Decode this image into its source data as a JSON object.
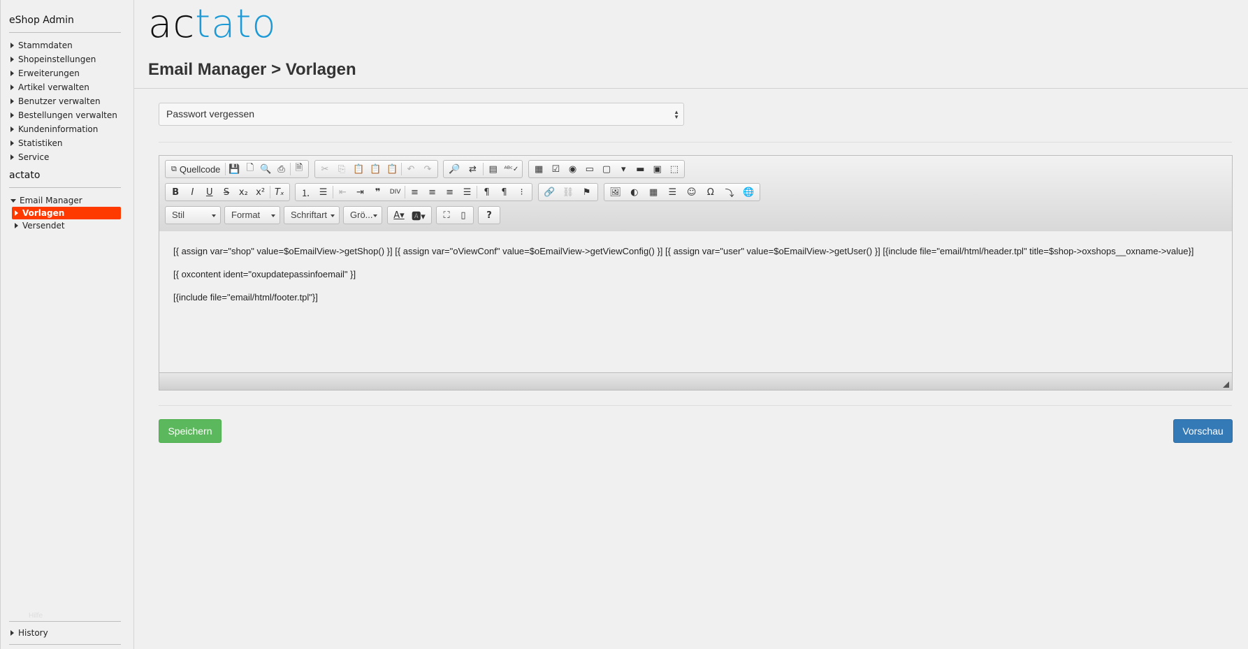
{
  "sidebar": {
    "title": "eShop Admin",
    "items": [
      {
        "label": "Stammdaten"
      },
      {
        "label": "Shopeinstellungen"
      },
      {
        "label": "Erweiterungen"
      },
      {
        "label": "Artikel verwalten"
      },
      {
        "label": "Benutzer verwalten"
      },
      {
        "label": "Bestellungen verwalten"
      },
      {
        "label": "Kundeninformation"
      },
      {
        "label": "Statistiken"
      },
      {
        "label": "Service"
      }
    ],
    "section_title": "actato",
    "section_group": "Email Manager",
    "section_items": [
      {
        "label": "Vorlagen",
        "active": true
      },
      {
        "label": "Versendet"
      }
    ],
    "faint_link": "Hilfe",
    "history": "History"
  },
  "logo": {
    "part1": "ac",
    "part2": "tat",
    "part3": "o",
    "accent_color": "#1d9ad6"
  },
  "page_title": "Email Manager > Vorlagen",
  "template_select": {
    "value": "Passwort vergessen"
  },
  "editor": {
    "source_button": "Quellcode",
    "combos": {
      "style": "Stil",
      "format": "Format",
      "font": "Schriftart",
      "size": "Grö..."
    },
    "content_lines": [
      "[{ assign var=\"shop\" value=$oEmailView->getShop() }] [{ assign var=\"oViewConf\" value=$oEmailView->getViewConfig() }] [{ assign var=\"user\" value=$oEmailView->getUser() }] [{include file=\"email/html/header.tpl\" title=$shop->oxshops__oxname->value}]",
      "[{ oxcontent ident=\"oxupdatepassinfoemail\" }]",
      "[{include file=\"email/html/footer.tpl\"}]"
    ]
  },
  "buttons": {
    "save": "Speichern",
    "preview": "Vorschau"
  },
  "colors": {
    "active": "#ff3a00",
    "save": "#5cb85c",
    "preview": "#337ab7"
  }
}
